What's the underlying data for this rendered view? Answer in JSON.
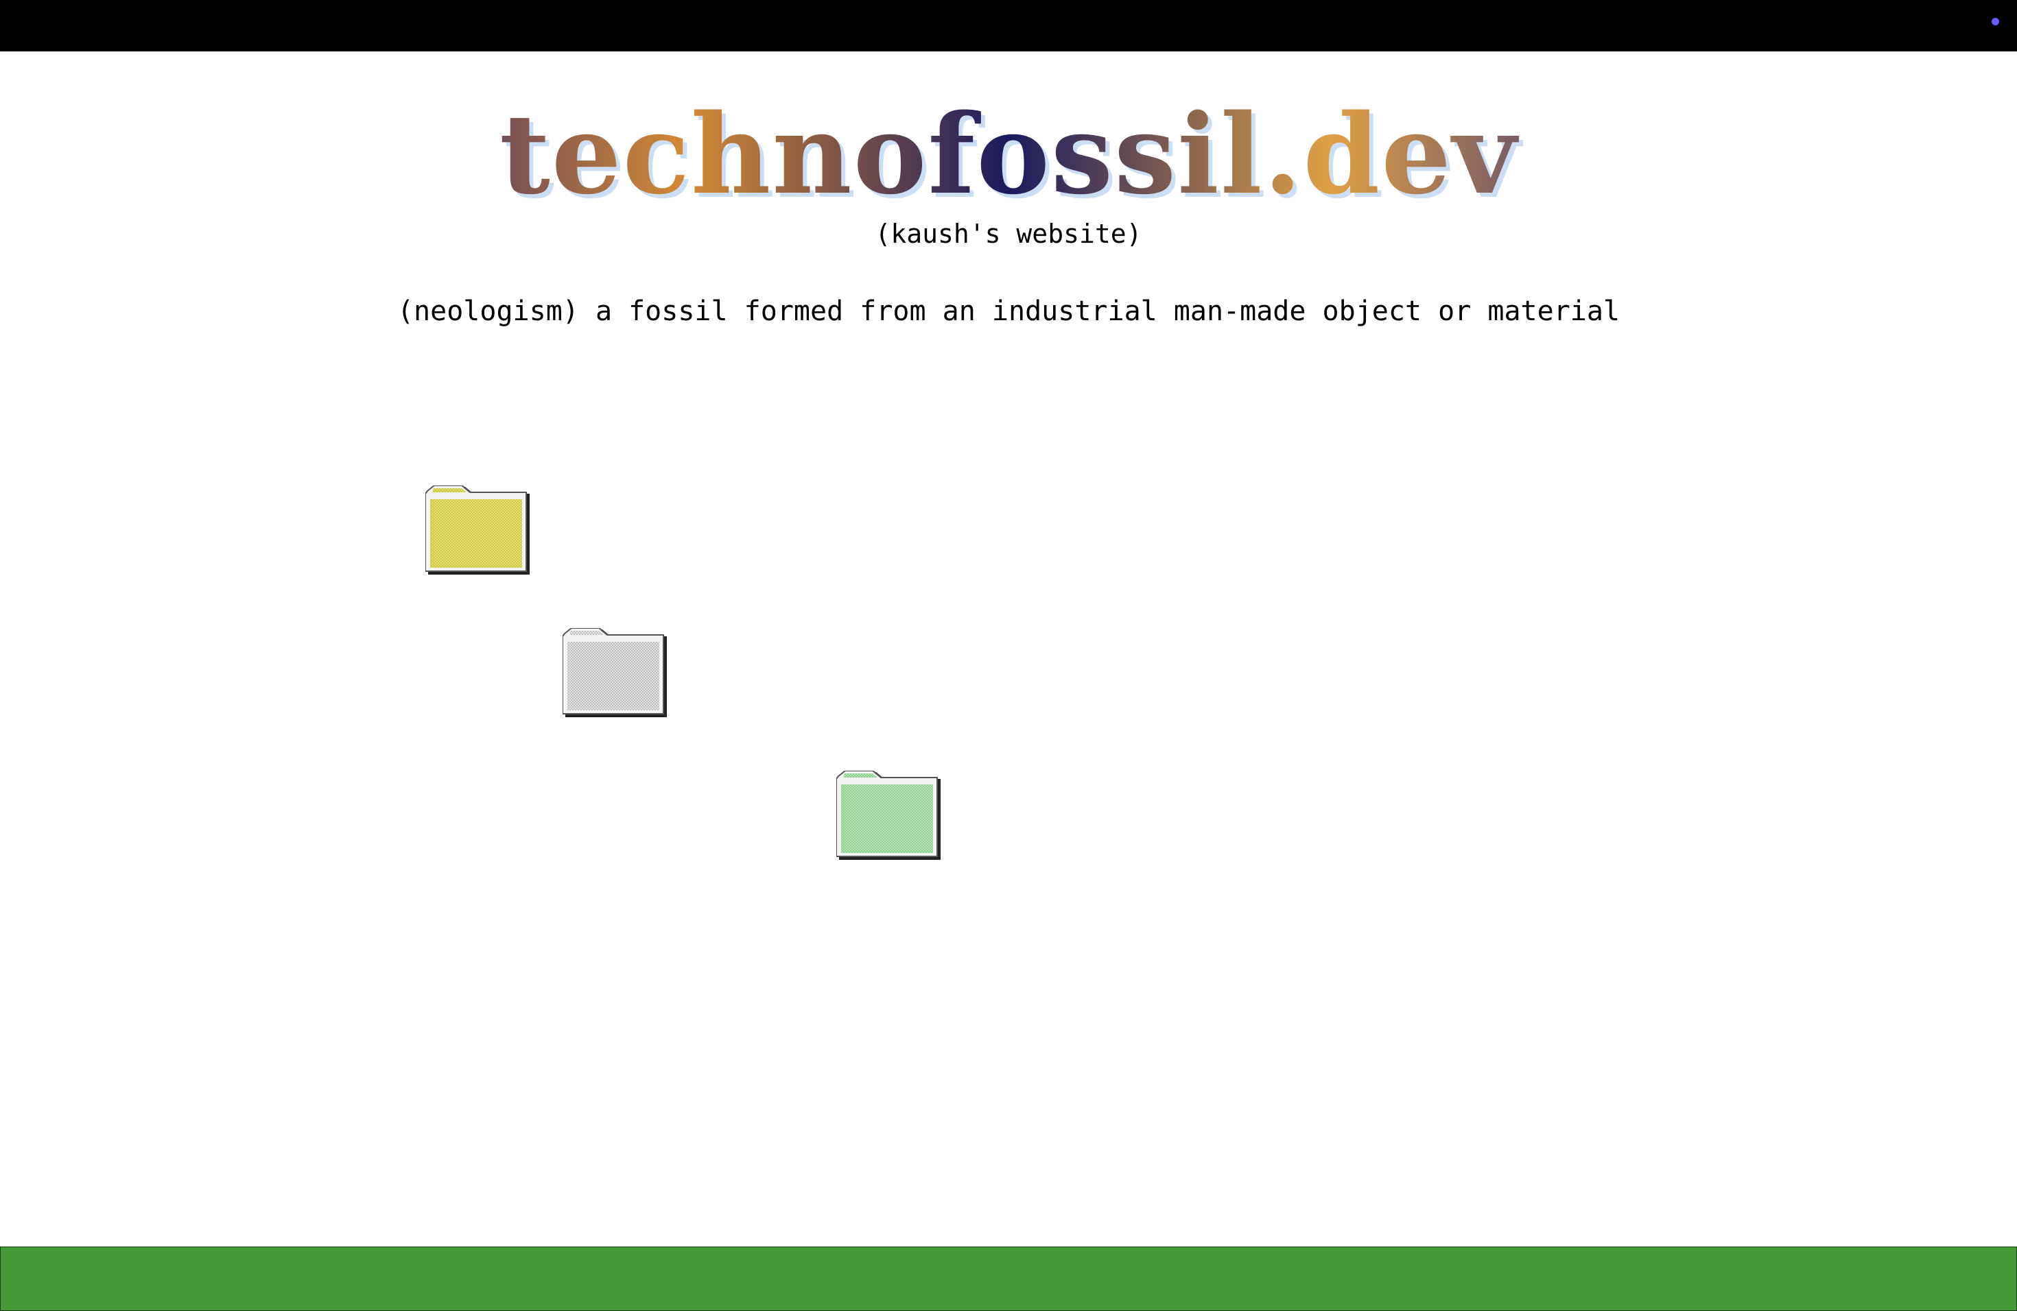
{
  "site": {
    "title": "technofossil.dev",
    "subtitle": "(kaush's website)",
    "definition": "(neologism) a fossil formed from an industrial man-made object or material"
  },
  "folders": [
    {
      "icon": "folder-icon",
      "color": "#e2df6a"
    },
    {
      "icon": "folder-icon",
      "color": "#dcdcdc"
    },
    {
      "icon": "folder-icon",
      "color": "#a6dba6"
    }
  ],
  "colors": {
    "top_bar": "#000000",
    "status_dot": "#6b5cff",
    "bottom_bar": "#459a36",
    "background": "#ffffff"
  }
}
